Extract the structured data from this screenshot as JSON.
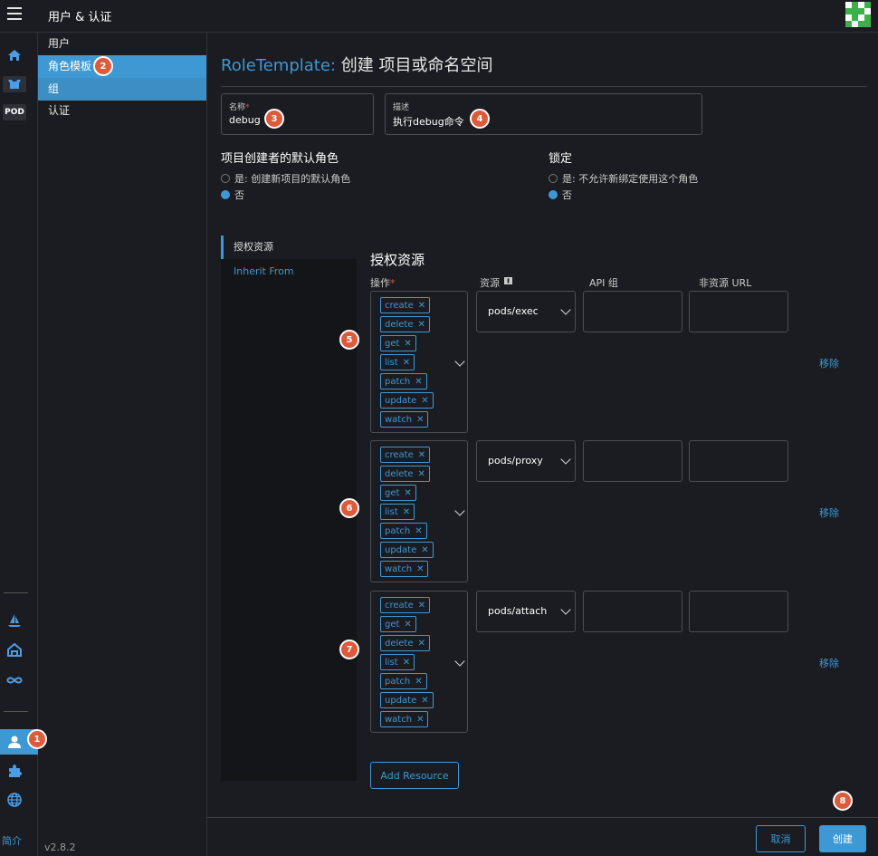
{
  "topbar": {
    "title": "用户 & 认证"
  },
  "rail": {
    "pod_label": "POD",
    "footer_link": "简介"
  },
  "nav": {
    "items": [
      {
        "label": "用户"
      },
      {
        "label": "角色模板"
      },
      {
        "label": "组"
      },
      {
        "label": "认证"
      }
    ],
    "version": "v2.8.2"
  },
  "page": {
    "title_prefix": "RoleTemplate:",
    "title_main": "创建 项目或命名空间"
  },
  "form": {
    "name": {
      "label": "名称",
      "required_mark": "*",
      "value": "debug"
    },
    "description": {
      "label": "描述",
      "value": "执行debug命令"
    }
  },
  "defaults": {
    "title": "项目创建者的默认角色",
    "options": [
      {
        "label": "是:  创建新项目的默认角色",
        "checked": false
      },
      {
        "label": "否",
        "checked": true
      }
    ]
  },
  "locked": {
    "title": "锁定",
    "options": [
      {
        "label": "是:  不允许新绑定使用这个角色",
        "checked": false
      },
      {
        "label": "否",
        "checked": true
      }
    ]
  },
  "tabs": [
    {
      "label": "授权资源"
    },
    {
      "label": "Inherit From"
    }
  ],
  "grants": {
    "section_title": "授权资源",
    "columns": {
      "verbs": "操作",
      "verbs_required": "*",
      "resource": "资源",
      "api_group": "API 组",
      "non_resource_url": "非资源 URL"
    },
    "rules": [
      {
        "verbs": [
          "create",
          "delete",
          "get",
          "list",
          "patch",
          "update",
          "watch"
        ],
        "resource": "pods/exec",
        "api_group": "",
        "non_resource_url": "",
        "remove_label": "移除"
      },
      {
        "verbs": [
          "create",
          "delete",
          "get",
          "list",
          "patch",
          "update",
          "watch"
        ],
        "resource": "pods/proxy",
        "api_group": "",
        "non_resource_url": "",
        "remove_label": "移除"
      },
      {
        "verbs": [
          "create",
          "get",
          "delete",
          "list",
          "patch",
          "update",
          "watch"
        ],
        "resource": "pods/attach",
        "api_group": "",
        "non_resource_url": "",
        "remove_label": "移除"
      }
    ],
    "add_label": "Add Resource"
  },
  "footer": {
    "cancel_label": "取消",
    "create_label": "创建"
  },
  "markers": [
    "1",
    "2",
    "3",
    "4",
    "5",
    "6",
    "7",
    "8"
  ],
  "colors": {
    "accent": "#3d98d3",
    "marker": "#dd5b3b",
    "background": "#1b1c21"
  }
}
